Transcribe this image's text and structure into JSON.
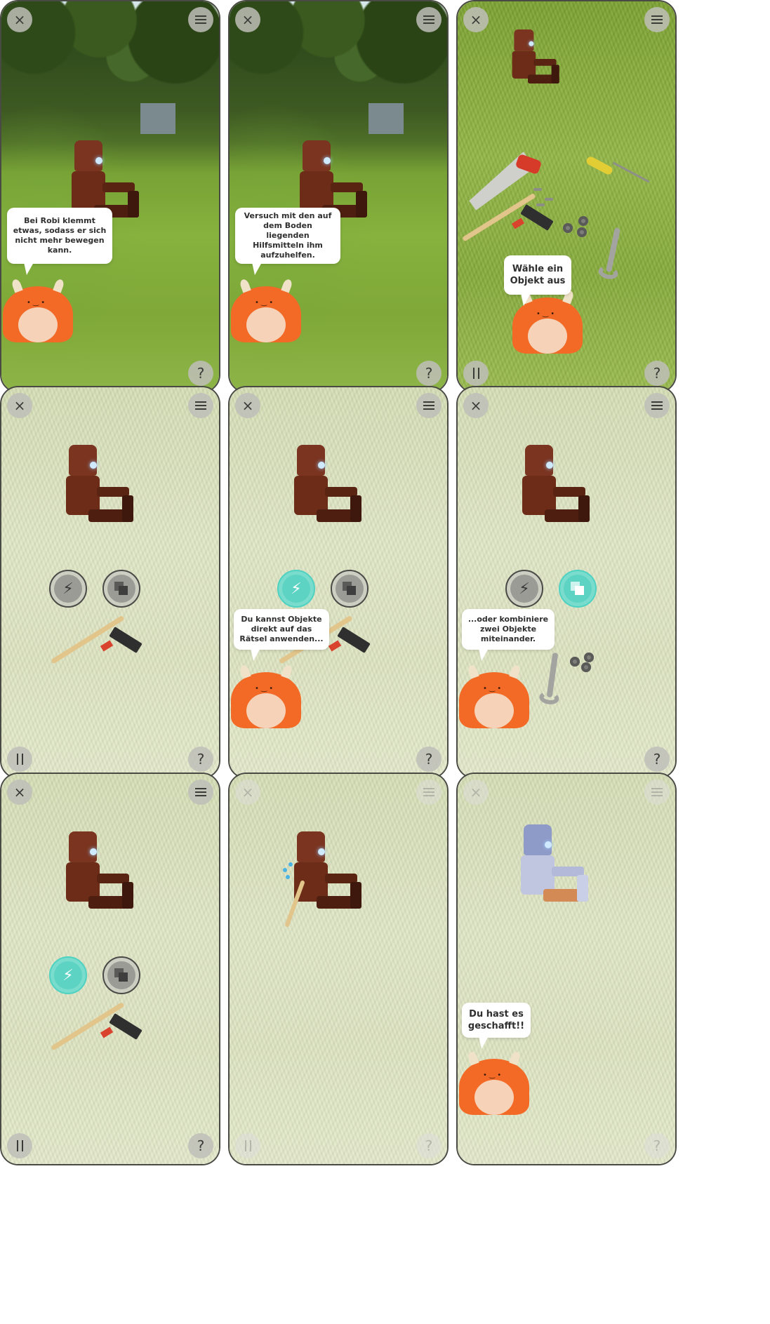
{
  "icons": {
    "close": "×",
    "help": "?",
    "bolt": "⚡"
  },
  "colors": {
    "accent_teal": "#5dd3c4",
    "monster_orange": "#f26a26",
    "robot_rust": "#7a3420",
    "frame": "#4a4a44"
  },
  "screens": {
    "s1": {
      "bubble": "Bei Robi klemmt etwas, sodass er sich nicht mehr bewegen kann."
    },
    "s2": {
      "bubble": "Versuch mit den auf dem Boden liegenden Hilfsmitteln ihm aufzuhelfen."
    },
    "s3": {
      "bubble": "Wähle ein Objekt aus"
    },
    "s4": {},
    "s5": {
      "bubble": "Du kannst Objekte direkt auf das Rätsel anwenden..."
    },
    "s6": {
      "bubble": "...oder kombiniere zwei Objekte miteinander."
    },
    "s7": {},
    "s8": {},
    "s9": {
      "bubble": "Du hast es geschafft!!"
    }
  }
}
